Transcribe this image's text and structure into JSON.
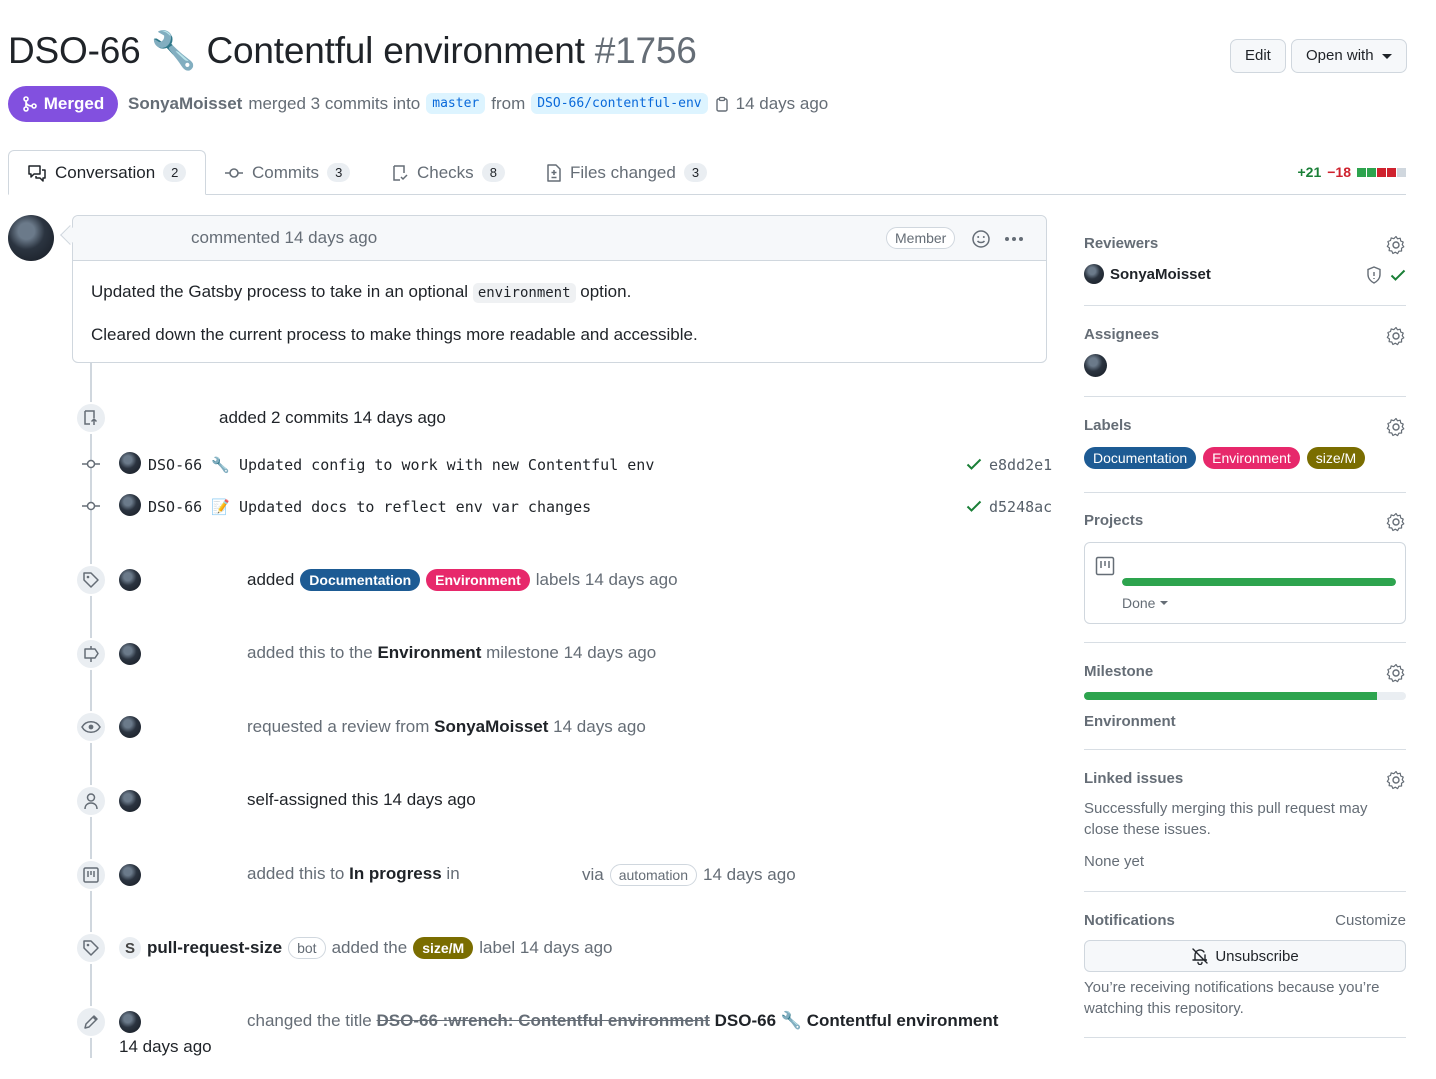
{
  "header": {
    "title_key": "DSO-66",
    "title_emoji": "🔧",
    "title_text": "Contentful environment",
    "pr_number": "#1756",
    "edit_label": "Edit",
    "open_with_label": "Open with"
  },
  "status": {
    "state": "Merged",
    "author": "SonyaMoisset",
    "merged_text": "merged 3 commits into",
    "base_branch": "master",
    "from_text": "from",
    "head_branch": "DSO-66/contentful-env",
    "time": "14 days ago"
  },
  "tabs": [
    {
      "label": "Conversation",
      "count": "2",
      "icon": "comment-discussion-icon",
      "active": true
    },
    {
      "label": "Commits",
      "count": "3",
      "icon": "git-commit-icon"
    },
    {
      "label": "Checks",
      "count": "8",
      "icon": "checklist-icon"
    },
    {
      "label": "Files changed",
      "count": "3",
      "icon": "file-diff-icon"
    }
  ],
  "diffstat": {
    "additions": "+21",
    "deletions": "−18",
    "colors": {
      "add": "#2da44e",
      "del": "#cf222e",
      "neutral": "#d0d7de"
    }
  },
  "comment": {
    "action": "commented 14 days ago",
    "role": "Member",
    "body_1_pre": "Updated the Gatsby process to take in an optional",
    "body_1_code": "environment",
    "body_1_post": "option.",
    "body_2": "Cleared down the current process to make things more readable and accessible."
  },
  "timeline": {
    "commits_event": "added 2 commits 14 days ago",
    "commits": [
      {
        "prefix": "DSO-66",
        "emoji": "🔧",
        "message": "Updated config to work with new Contentful env",
        "sha": "e8dd2e1"
      },
      {
        "prefix": "DSO-66",
        "emoji": "📝",
        "message": "Updated docs to reflect env var changes",
        "sha": "d5248ac"
      }
    ],
    "labels_event": {
      "pre": "added",
      "label_1": "Documentation",
      "label_2": "Environment",
      "post": "labels 14 days ago"
    },
    "milestone_event": {
      "pre": "added this to the",
      "milestone": "Environment",
      "post": "milestone 14 days ago"
    },
    "review_event": {
      "pre": "requested a review from",
      "user": "SonyaMoisset",
      "post": "14 days ago"
    },
    "assign_event": "self-assigned this 14 days ago",
    "project_event": {
      "pre": "added this to",
      "column": "In progress",
      "in": "in",
      "via": "via",
      "automation": "automation",
      "post": "14 days ago"
    },
    "bot_event": {
      "bot": "pull-request-size",
      "bot_badge": "bot",
      "pre": "added the",
      "label": "size/M",
      "post": "label 14 days ago"
    },
    "title_event": {
      "pre": "changed the title",
      "old_title": "DSO-66 :wrench: Contentful environment",
      "new_key": "DSO-66",
      "new_emoji": "🔧",
      "new_text": "Contentful environment",
      "time": "14 days ago"
    }
  },
  "sidebar": {
    "reviewers": {
      "heading": "Reviewers",
      "user": "SonyaMoisset"
    },
    "assignees": {
      "heading": "Assignees"
    },
    "labels": {
      "heading": "Labels",
      "items": [
        "Documentation",
        "Environment",
        "size/M"
      ]
    },
    "projects": {
      "heading": "Projects",
      "status": "Done",
      "progress": 1.0
    },
    "milestone": {
      "heading": "Milestone",
      "name": "Environment",
      "progress": 0.91
    },
    "linked_issues": {
      "heading": "Linked issues",
      "description": "Successfully merging this pull request may close these issues.",
      "none": "None yet"
    },
    "notifications": {
      "heading": "Notifications",
      "customize": "Customize",
      "button": "Unsubscribe",
      "description": "You’re receiving notifications because you’re watching this repository."
    }
  },
  "colors": {
    "merged": "#8250df",
    "documentation": "#1d5b94",
    "environment": "#e7286b",
    "size": "#7a6d00",
    "progress": "#2da44e"
  }
}
